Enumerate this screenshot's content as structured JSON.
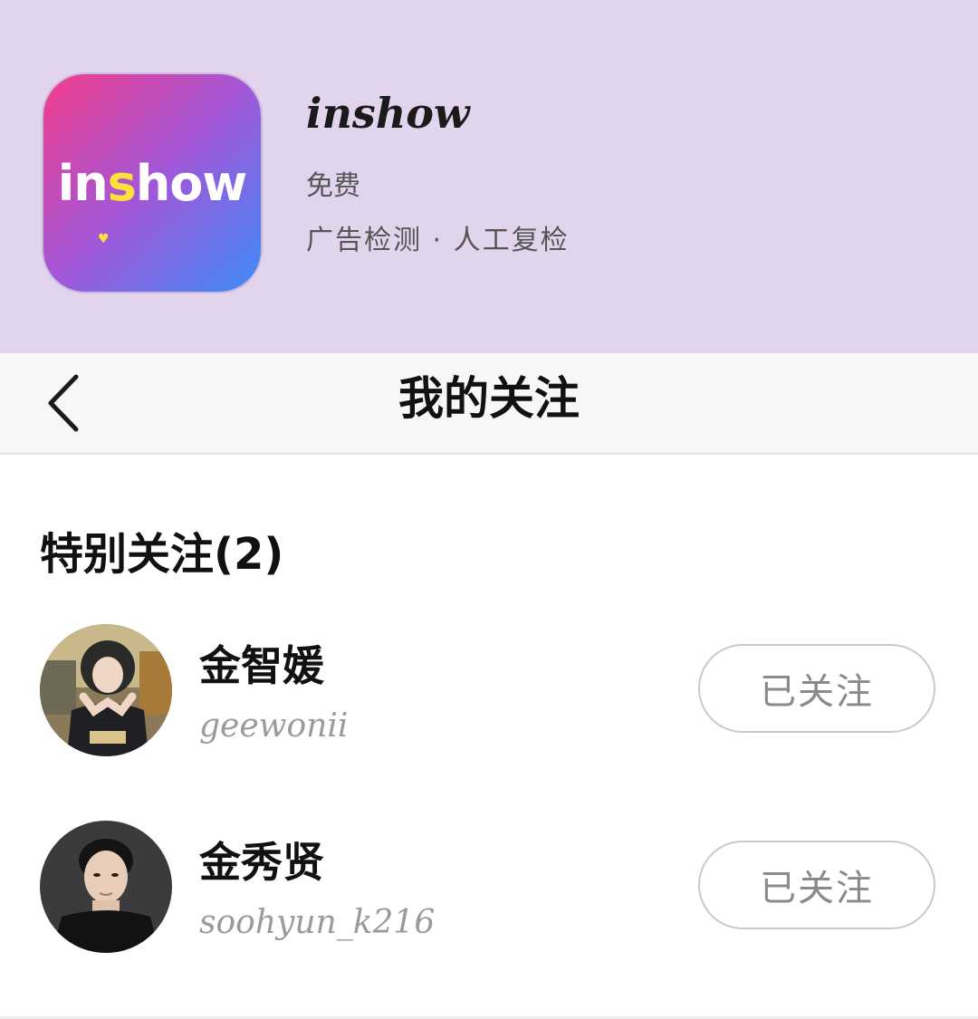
{
  "banner": {
    "icon_text_parts": [
      "in",
      "s",
      "how"
    ],
    "app_name": "inshow",
    "price": "免费",
    "tags": "广告检测 · 人工复检"
  },
  "navbar": {
    "back_icon": "chevron-left-icon",
    "title": "我的关注"
  },
  "section": {
    "title": "特别关注(2)"
  },
  "follows": [
    {
      "name": "金智媛",
      "handle": "geewonii",
      "button_label": "已关注"
    },
    {
      "name": "金秀贤",
      "handle": "soohyun_k216",
      "button_label": "已关注"
    }
  ],
  "colors": {
    "banner_bg": "#e1d4ec",
    "icon_gradient_start": "#f23d8a",
    "icon_gradient_end": "#3d8bf7",
    "icon_highlight": "#ffe03b",
    "navbar_bg": "#f7f7f7",
    "handle_text": "#9a9a9a",
    "button_border": "#c9c9c9"
  }
}
